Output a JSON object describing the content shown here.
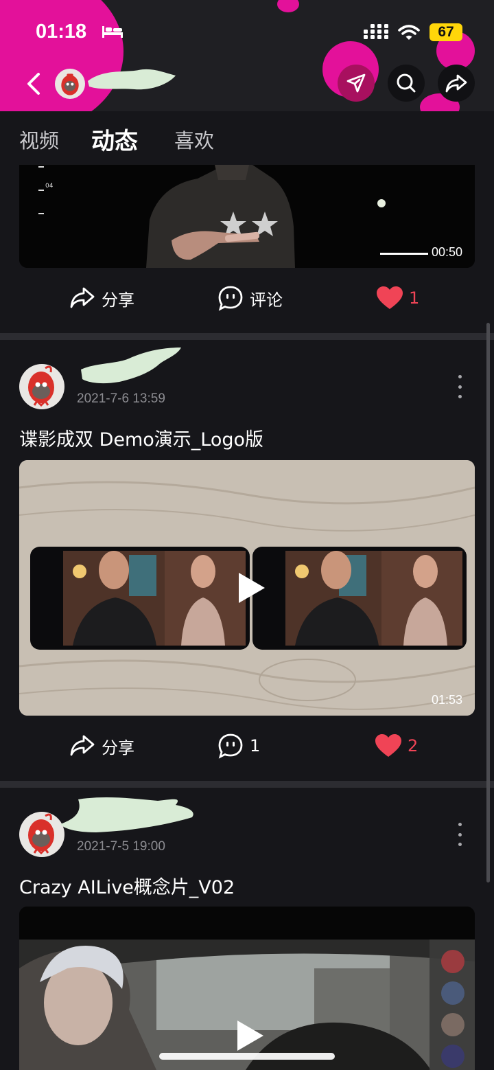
{
  "status_bar": {
    "time": "01:18",
    "battery": "67"
  },
  "header": {
    "icons": [
      "back-icon",
      "paper-plane-icon",
      "search-icon",
      "share-arrow-icon"
    ]
  },
  "tabs": [
    {
      "label": "视频",
      "active": false
    },
    {
      "label": "动态",
      "active": true
    },
    {
      "label": "喜欢",
      "active": false
    }
  ],
  "posts": [
    {
      "video": {
        "duration": "00:50",
        "overlay_num": "04"
      },
      "actions": {
        "share": "分享",
        "comment": "评论",
        "likes": "1"
      }
    },
    {
      "date": "2021-7-6 13:59",
      "title": "谍影成双 Demo演示_Logo版",
      "video": {
        "duration": "01:53"
      },
      "actions": {
        "share": "分享",
        "comment": "1",
        "likes": "2"
      }
    },
    {
      "date": "2021-7-5 19:00",
      "title": "Crazy AILive概念片_V02"
    }
  ],
  "colors": {
    "accent": "#e3119a",
    "like": "#f04456",
    "background": "#16161a",
    "header": "#1f1f23"
  }
}
